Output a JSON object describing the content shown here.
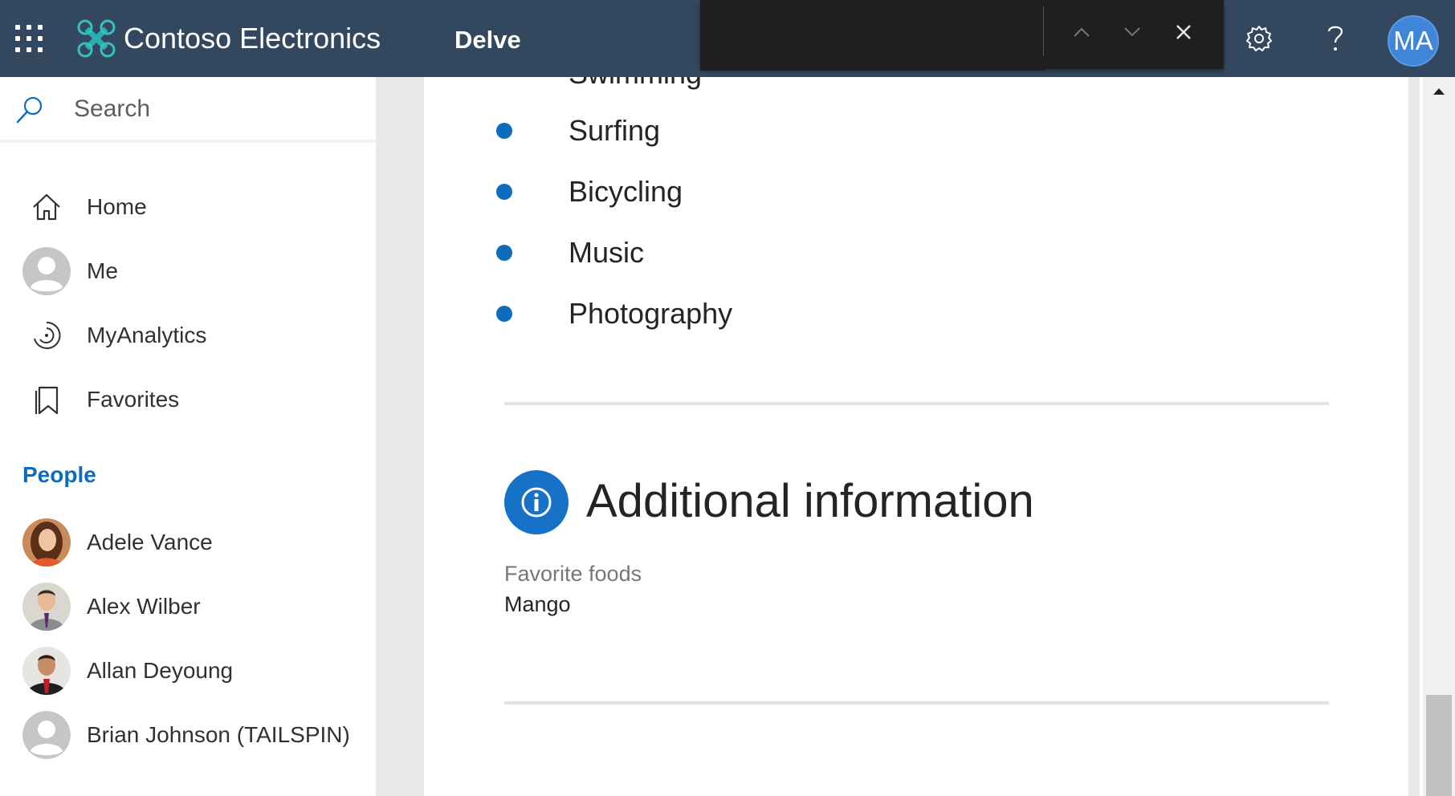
{
  "header": {
    "brand_name": "Contoso Electronics",
    "app_name": "Delve",
    "user_initials": "MA",
    "accent_color": "#33485f",
    "avatar_color": "#3f86d9"
  },
  "findbar": {
    "icons": [
      "chevron-up-icon",
      "chevron-down-icon",
      "close-icon"
    ]
  },
  "sidebar": {
    "search_placeholder": "Search",
    "nav_items": [
      {
        "label": "Home",
        "icon": "home-icon"
      },
      {
        "label": "Me",
        "icon": "person-icon"
      },
      {
        "label": "MyAnalytics",
        "icon": "analytics-icon"
      },
      {
        "label": "Favorites",
        "icon": "bookmark-icon"
      }
    ],
    "people_heading": "People",
    "people": [
      {
        "name": "Adele Vance"
      },
      {
        "name": "Alex Wilber"
      },
      {
        "name": "Allan Deyoung"
      },
      {
        "name": "Brian Johnson (TAILSPIN)"
      }
    ]
  },
  "main": {
    "partial_item": "Swimming",
    "interests": [
      "Surfing",
      "Bicycling",
      "Music",
      "Photography"
    ],
    "section_title": "Additional information",
    "field_label": "Favorite foods",
    "field_value": "Mango"
  }
}
